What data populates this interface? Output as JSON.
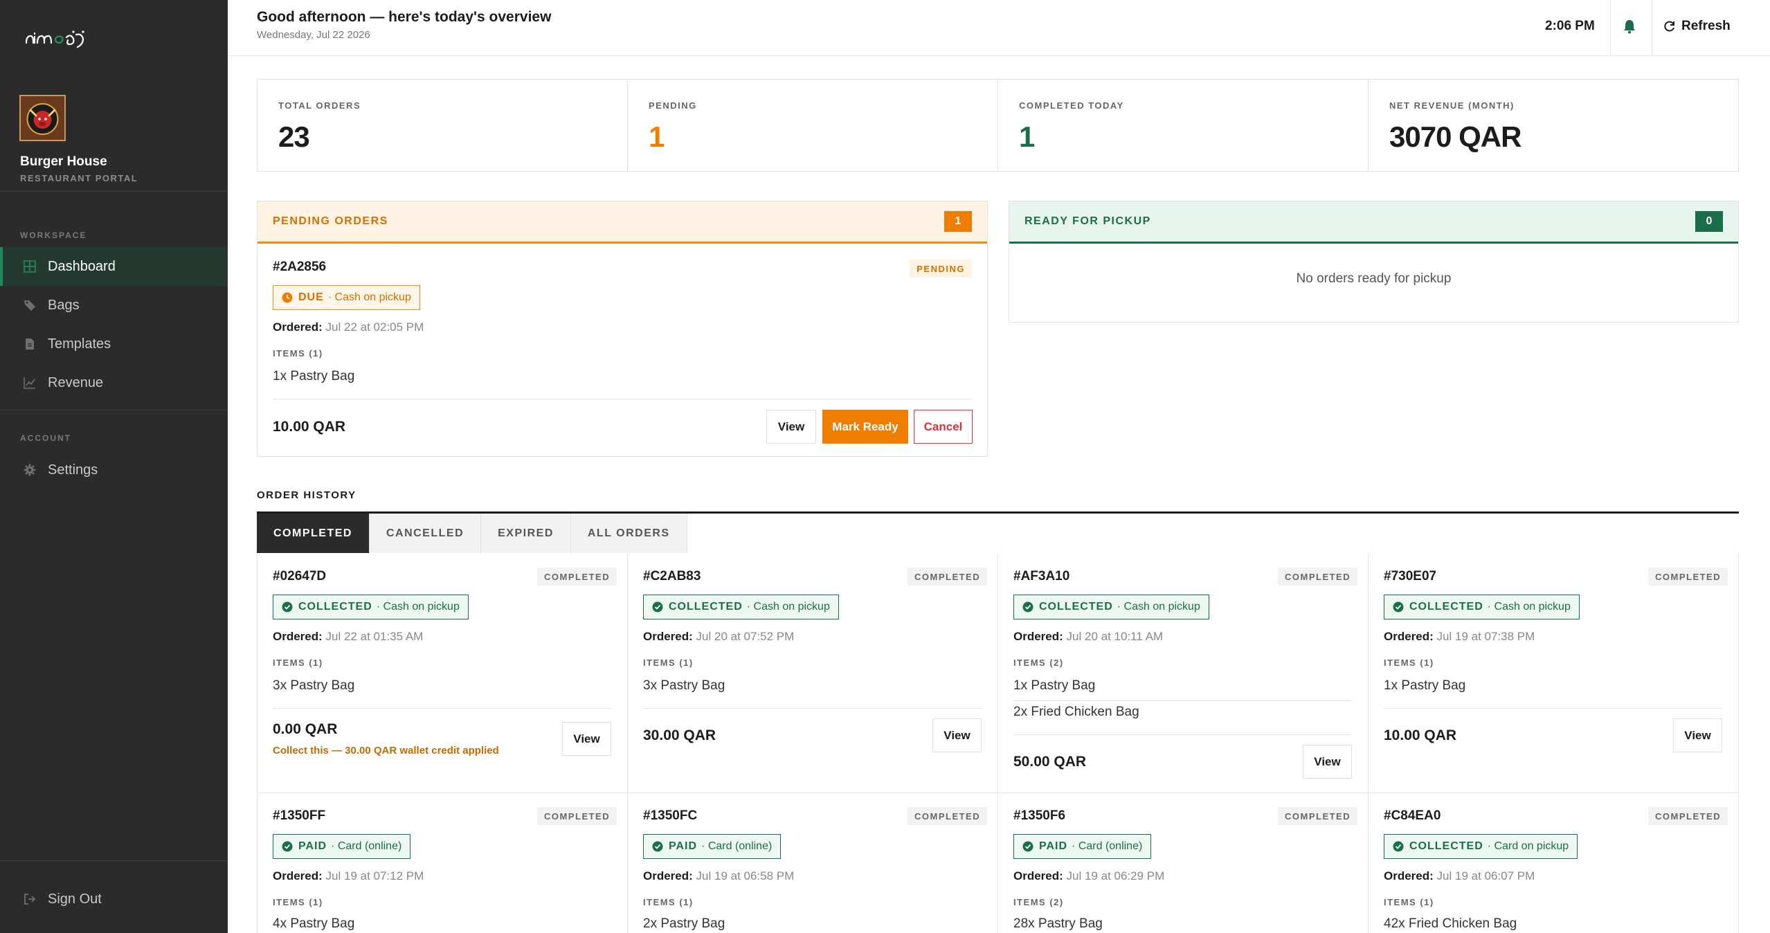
{
  "sidebar": {
    "logo_text": "nimaqi",
    "brand_name": "Burger House",
    "brand_sub": "RESTAURANT PORTAL",
    "workspace_label": "WORKSPACE",
    "account_label": "ACCOUNT",
    "items": [
      {
        "label": "Dashboard",
        "icon": "grid-icon",
        "active": true
      },
      {
        "label": "Bags",
        "icon": "tag-icon"
      },
      {
        "label": "Templates",
        "icon": "document-icon"
      },
      {
        "label": "Revenue",
        "icon": "chart-icon"
      }
    ],
    "settings_label": "Settings",
    "signout_label": "Sign Out"
  },
  "header": {
    "greeting": "Good afternoon — here's today's overview",
    "date": "Wednesday, Jul 22 2026",
    "time": "2:06 PM",
    "refresh_label": "Refresh"
  },
  "stats": [
    {
      "label": "TOTAL ORDERS",
      "value": "23"
    },
    {
      "label": "PENDING",
      "value": "1"
    },
    {
      "label": "COMPLETED TODAY",
      "value": "1"
    },
    {
      "label": "NET REVENUE (MONTH)",
      "value": "3070 QAR"
    }
  ],
  "pending_panel": {
    "title": "PENDING ORDERS",
    "count": "1",
    "order": {
      "id": "#2A2856",
      "status": "PENDING",
      "pay_status": "DUE",
      "pay_method": "· Cash on pickup",
      "ordered_label": "Ordered:",
      "ordered_value": "Jul 22 at 02:05 PM",
      "items_label": "ITEMS (1)",
      "items": [
        "1x Pastry Bag"
      ],
      "total": "10.00 QAR",
      "view_label": "View",
      "ready_label": "Mark Ready",
      "cancel_label": "Cancel"
    }
  },
  "ready_panel": {
    "title": "READY FOR PICKUP",
    "count": "0",
    "empty": "No orders ready for pickup"
  },
  "history": {
    "title": "ORDER HISTORY",
    "tabs": [
      "COMPLETED",
      "CANCELLED",
      "EXPIRED",
      "ALL ORDERS"
    ],
    "view_label": "View",
    "ordered_label": "Ordered:",
    "orders": [
      {
        "id": "#02647D",
        "status": "COMPLETED",
        "pay_status": "COLLECTED",
        "pay_method": "· Cash on pickup",
        "ordered": "Jul 22 at 01:35 AM",
        "items_label": "ITEMS (1)",
        "items": [
          "3x Pastry Bag"
        ],
        "total": "0.00 QAR",
        "note": "Collect this — 30.00 QAR wallet credit applied"
      },
      {
        "id": "#C2AB83",
        "status": "COMPLETED",
        "pay_status": "COLLECTED",
        "pay_method": "· Cash on pickup",
        "ordered": "Jul 20 at 07:52 PM",
        "items_label": "ITEMS (1)",
        "items": [
          "3x Pastry Bag"
        ],
        "total": "30.00 QAR"
      },
      {
        "id": "#AF3A10",
        "status": "COMPLETED",
        "pay_status": "COLLECTED",
        "pay_method": "· Cash on pickup",
        "ordered": "Jul 20 at 10:11 AM",
        "items_label": "ITEMS (2)",
        "items": [
          "1x Pastry Bag",
          "2x Fried Chicken Bag"
        ],
        "total": "50.00 QAR"
      },
      {
        "id": "#730E07",
        "status": "COMPLETED",
        "pay_status": "COLLECTED",
        "pay_method": "· Cash on pickup",
        "ordered": "Jul 19 at 07:38 PM",
        "items_label": "ITEMS (1)",
        "items": [
          "1x Pastry Bag"
        ],
        "total": "10.00 QAR"
      },
      {
        "id": "#1350FF",
        "status": "COMPLETED",
        "pay_status": "PAID",
        "pay_method": "· Card (online)",
        "ordered": "Jul 19 at 07:12 PM",
        "items_label": "ITEMS (1)",
        "items": [
          "4x Pastry Bag"
        ]
      },
      {
        "id": "#1350FC",
        "status": "COMPLETED",
        "pay_status": "PAID",
        "pay_method": "· Card (online)",
        "ordered": "Jul 19 at 06:58 PM",
        "items_label": "ITEMS (1)",
        "items": [
          "2x Pastry Bag"
        ]
      },
      {
        "id": "#1350F6",
        "status": "COMPLETED",
        "pay_status": "PAID",
        "pay_method": "· Card (online)",
        "ordered": "Jul 19 at 06:29 PM",
        "items_label": "ITEMS (2)",
        "items": [
          "28x Pastry Bag"
        ]
      },
      {
        "id": "#C84EA0",
        "status": "COMPLETED",
        "pay_status": "COLLECTED",
        "pay_method": "· Card on pickup",
        "ordered": "Jul 19 at 06:07 PM",
        "items_label": "ITEMS (1)",
        "items": [
          "42x Fried Chicken Bag"
        ]
      }
    ]
  },
  "colors": {
    "sidebar_bg": "#2b2b2b",
    "accent_green": "#1b6e4a",
    "accent_orange": "#ef7d00",
    "cancel_red": "#e0303a"
  }
}
